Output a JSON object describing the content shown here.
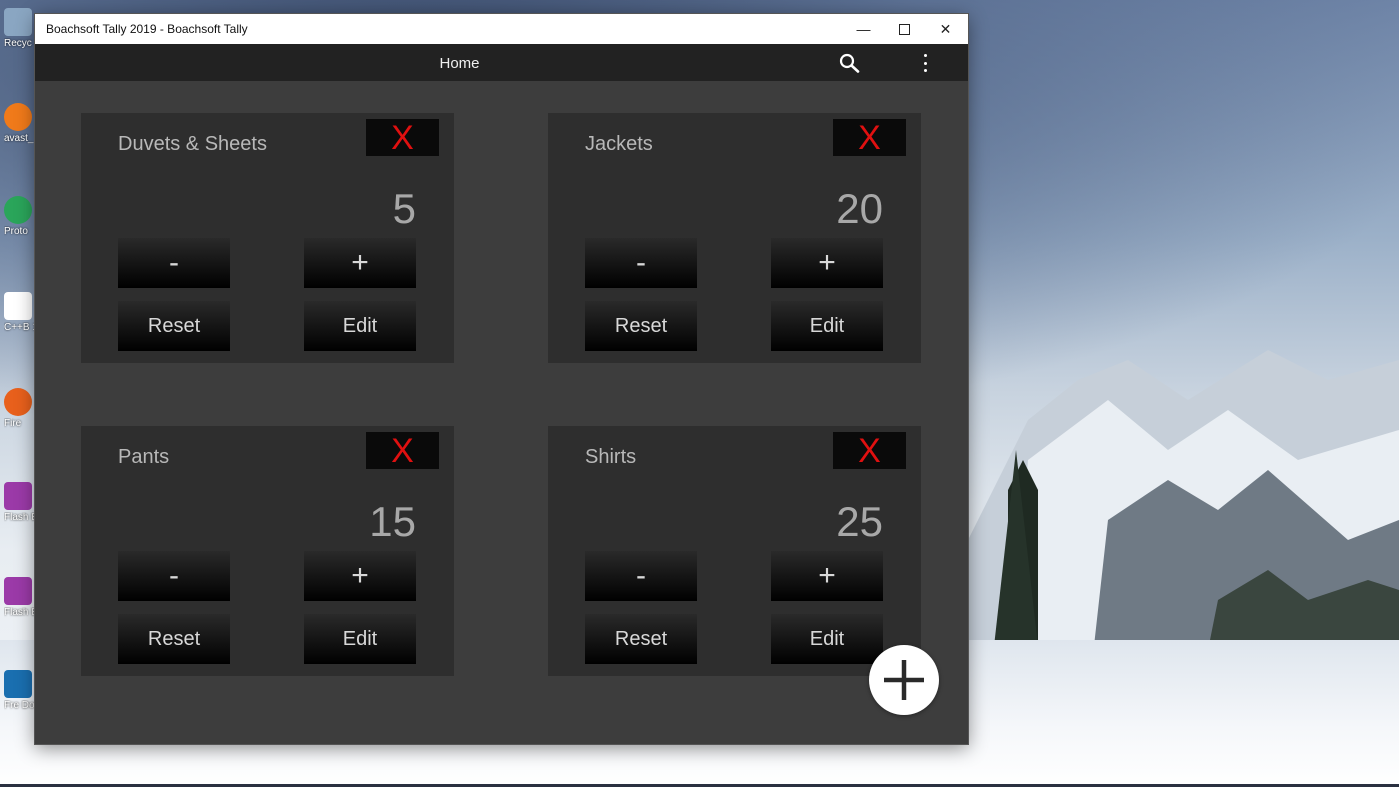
{
  "window": {
    "title": "Boachsoft Tally 2019 - Boachsoft Tally",
    "minimize_glyph": "—",
    "close_glyph": "✕"
  },
  "appbar": {
    "title": "Home",
    "search_icon": "search-icon",
    "more_icon": "more-vertical-icon"
  },
  "desktop": {
    "icons": [
      {
        "label": "Recyc",
        "color": "#8aa6c2"
      },
      {
        "label": "avast_",
        "color": "#f07a1a"
      },
      {
        "label": "Proto",
        "color": "#2aa55a"
      },
      {
        "label": "C++B 10",
        "color": "#ffffff"
      },
      {
        "label": "Fire",
        "color": "#e8601c"
      },
      {
        "label": "Flash Expr",
        "color": "#9b3aa8"
      },
      {
        "label": "Flash Expr",
        "color": "#9b3aa8"
      },
      {
        "label": "Fre Down",
        "color": "#1a6fb0"
      }
    ]
  },
  "counters": [
    {
      "name": "Duvets & Sheets",
      "count": "5"
    },
    {
      "name": "Jackets",
      "count": "20"
    },
    {
      "name": "Pants",
      "count": "15"
    },
    {
      "name": "Shirts",
      "count": "25"
    }
  ],
  "labels": {
    "delete": "X",
    "minus": "-",
    "plus": "+",
    "reset": "Reset",
    "edit": "Edit"
  },
  "colors": {
    "delete_x": "#e01010",
    "card_bg": "#2e2e2e",
    "window_bg": "#3d3d3d",
    "appbar_bg": "#222222"
  },
  "fab": {
    "icon": "plus-icon"
  }
}
